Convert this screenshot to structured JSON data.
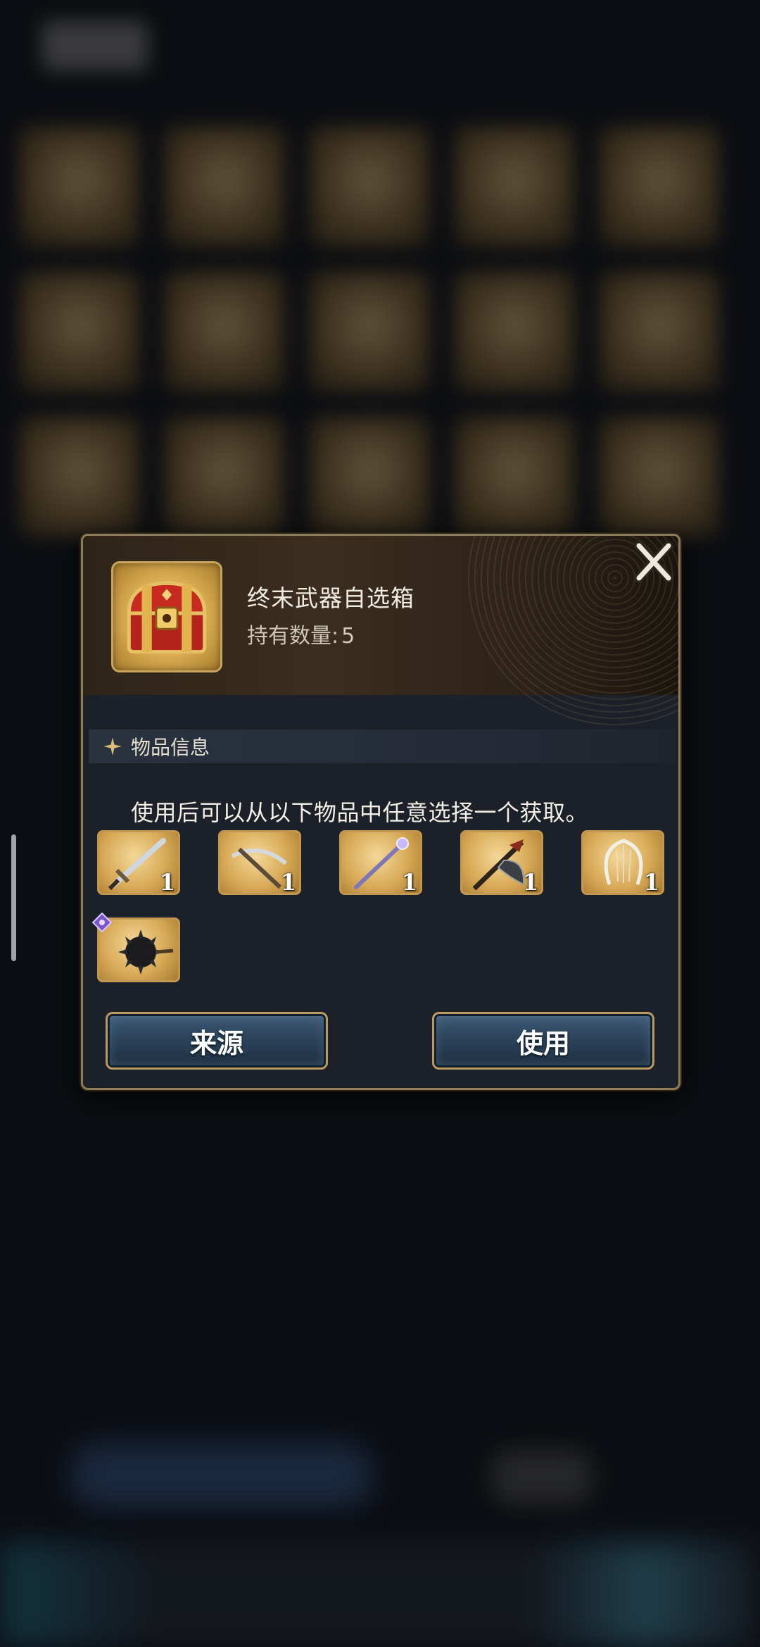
{
  "dialog": {
    "item_name": "终末武器自选箱",
    "count_label": "持有数量:",
    "count_value": "5",
    "close_icon": "close-x-icon",
    "section_title": "物品信息",
    "description": "使用后可以从以下物品中任意选择一个获取。",
    "rewards": [
      {
        "icon": "sword-icon",
        "qty": "1"
      },
      {
        "icon": "scythe-icon",
        "qty": "1"
      },
      {
        "icon": "staff-icon",
        "qty": "1"
      },
      {
        "icon": "axe-icon",
        "qty": "1"
      },
      {
        "icon": "harp-icon",
        "qty": "1"
      },
      {
        "icon": "spiked-mace-icon",
        "qty": "",
        "badge": "purple-gem-icon"
      }
    ],
    "buttons": {
      "source_label": "来源",
      "use_label": "使用"
    },
    "colors": {
      "frame_gold": "#8e7c57",
      "button_blue": "#2c435a",
      "item_gold": "#d8aa58"
    }
  }
}
